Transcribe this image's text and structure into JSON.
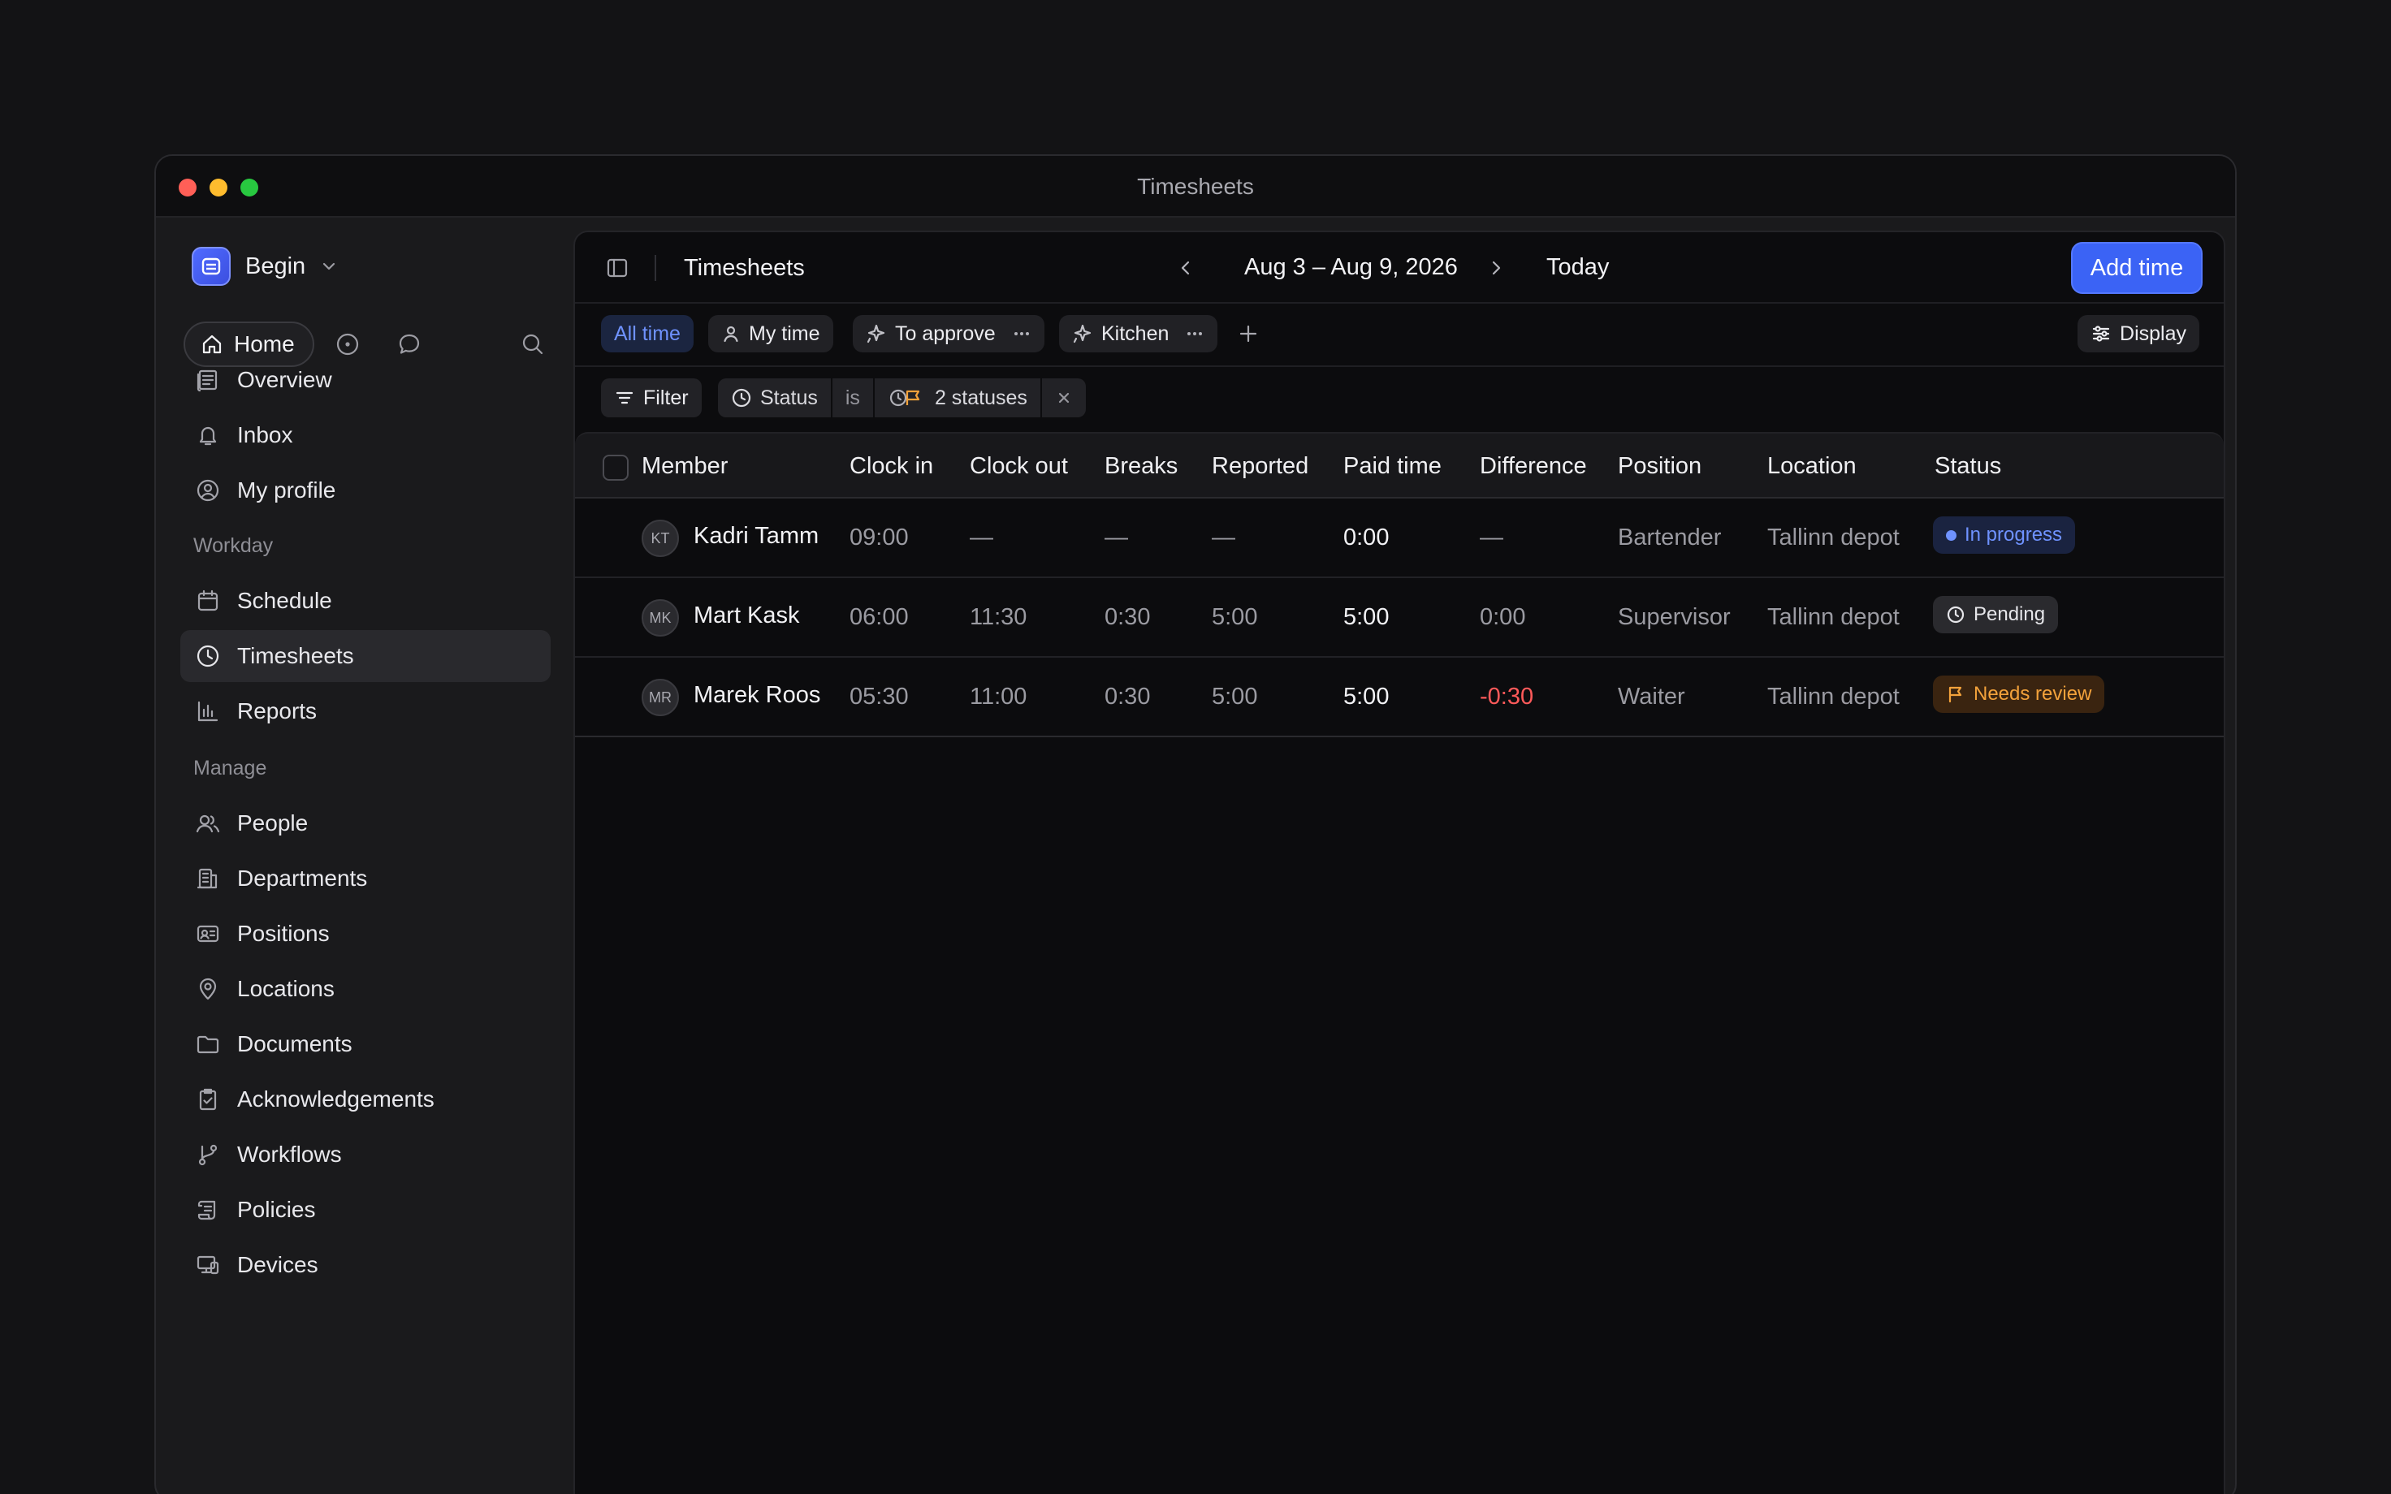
{
  "window": {
    "title": "Timesheets"
  },
  "sidebar": {
    "workspace": {
      "name": "Begin"
    },
    "home_label": "Home",
    "top_items": [
      {
        "label": "Overview"
      },
      {
        "label": "Inbox"
      },
      {
        "label": "My profile"
      }
    ],
    "sections": [
      {
        "title": "Workday",
        "items": [
          {
            "label": "Schedule"
          },
          {
            "label": "Timesheets",
            "active": true
          },
          {
            "label": "Reports"
          }
        ]
      },
      {
        "title": "Manage",
        "items": [
          {
            "label": "People"
          },
          {
            "label": "Departments"
          },
          {
            "label": "Positions"
          },
          {
            "label": "Locations"
          },
          {
            "label": "Documents"
          },
          {
            "label": "Acknowledgements"
          },
          {
            "label": "Workflows"
          },
          {
            "label": "Policies"
          },
          {
            "label": "Devices"
          }
        ]
      }
    ]
  },
  "toolbar": {
    "title": "Timesheets",
    "date_range": "Aug 3 – Aug 9, 2026",
    "today_label": "Today",
    "add_label": "Add time"
  },
  "views": [
    {
      "label": "All time",
      "active": true
    },
    {
      "label": "My time"
    },
    {
      "label": "To approve"
    },
    {
      "label": "Kitchen"
    }
  ],
  "display_label": "Display",
  "filter": {
    "button_label": "Filter",
    "field": "Status",
    "operator": "is",
    "value": "2 statuses"
  },
  "table": {
    "columns": [
      "Member",
      "Clock in",
      "Clock out",
      "Breaks",
      "Reported",
      "Paid time",
      "Difference",
      "Position",
      "Location",
      "Status"
    ],
    "rows": [
      {
        "initials": "KT",
        "member": "Kadri Tamm",
        "clock_in": "09:00",
        "clock_out": "—",
        "breaks": "—",
        "reported": "—",
        "paid": "0:00",
        "difference": "—",
        "position": "Bartender",
        "location": "Tallinn depot",
        "status": "In progress"
      },
      {
        "initials": "MK",
        "member": "Mart Kask",
        "clock_in": "06:00",
        "clock_out": "11:30",
        "breaks": "0:30",
        "reported": "5:00",
        "paid": "5:00",
        "difference": "0:00",
        "position": "Supervisor",
        "location": "Tallinn depot",
        "status": "Pending"
      },
      {
        "initials": "MR",
        "member": "Marek Roos",
        "clock_in": "05:30",
        "clock_out": "11:00",
        "breaks": "0:30",
        "reported": "5:00",
        "paid": "5:00",
        "difference": "-0:30",
        "position": "Waiter",
        "location": "Tallinn depot",
        "status": "Needs review"
      }
    ]
  },
  "colors": {
    "accent": "#3b63f5",
    "status_in_progress": "#6f92ff",
    "status_needs_review": "#f3a23b",
    "negative": "#ff5a5a"
  }
}
